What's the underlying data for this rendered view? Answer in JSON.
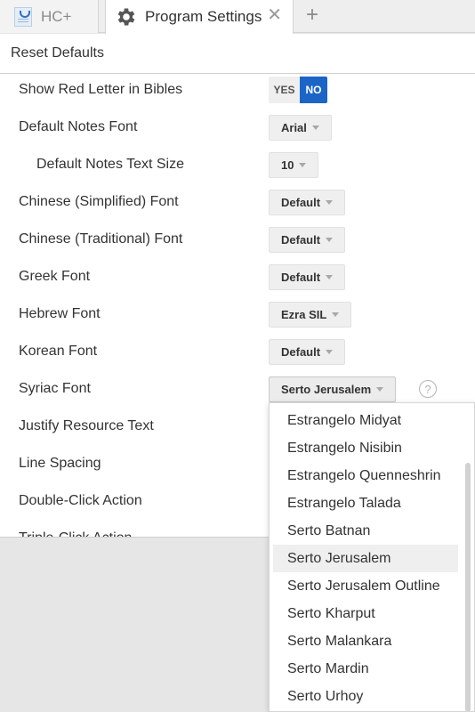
{
  "tabs": [
    {
      "label": "HC+",
      "icon": "document-logo-icon"
    },
    {
      "label": "Program Settings",
      "icon": "gear-icon",
      "close": "✕"
    }
  ],
  "add_tab": "+",
  "toolbar": {
    "reset_label": "Reset Defaults"
  },
  "settings": {
    "red_letter": {
      "label": "Show Red Letter in Bibles",
      "yes": "YES",
      "no": "NO",
      "value": "NO"
    },
    "notes_font": {
      "label": "Default Notes Font",
      "value": "Arial"
    },
    "notes_size": {
      "label": "Default Notes Text Size",
      "value": "10"
    },
    "chinese_simplified": {
      "label": "Chinese (Simplified) Font",
      "value": "Default"
    },
    "chinese_traditional": {
      "label": "Chinese (Traditional) Font",
      "value": "Default"
    },
    "greek": {
      "label": "Greek Font",
      "value": "Default"
    },
    "hebrew": {
      "label": "Hebrew Font",
      "value": "Ezra SIL"
    },
    "korean": {
      "label": "Korean Font",
      "value": "Default"
    },
    "syriac": {
      "label": "Syriac Font",
      "value": "Serto Jerusalem",
      "help": "?"
    },
    "justify": {
      "label": "Justify Resource Text"
    },
    "line_spacing": {
      "label": "Line Spacing"
    },
    "double_click": {
      "label": "Double-Click Action"
    },
    "triple_click": {
      "label": "Triple-Click Action"
    }
  },
  "syriac_options": [
    "Estrangelo Midyat",
    "Estrangelo Nisibin",
    "Estrangelo Quenneshrin",
    "Estrangelo Talada",
    "Serto Batnan",
    "Serto Jerusalem",
    "Serto Jerusalem Outline",
    "Serto Kharput",
    "Serto Malankara",
    "Serto Mardin",
    "Serto Urhoy"
  ],
  "syriac_selected": "Serto Jerusalem",
  "colors": {
    "accent": "#1b65c6",
    "panel": "#ffffff",
    "background": "#e6e6e6"
  }
}
